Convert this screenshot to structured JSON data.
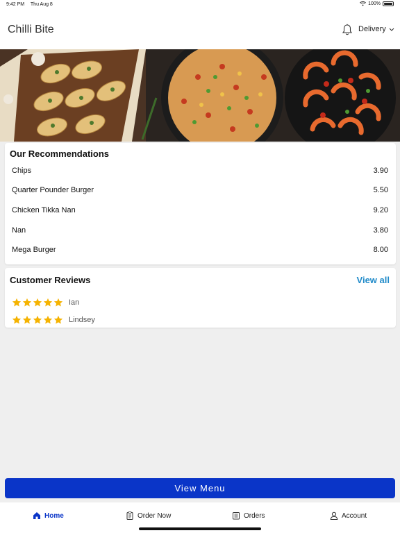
{
  "status_bar": {
    "time": "9:42 PM",
    "date": "Thu Aug 8",
    "battery": "100%"
  },
  "header": {
    "title": "Chilli Bite",
    "mode_label": "Delivery",
    "bell_icon": "bell-icon",
    "chevron_icon": "chevron-down-icon"
  },
  "recommendations": {
    "title": "Our Recommendations",
    "items": [
      {
        "name": "Chips",
        "price": "3.90"
      },
      {
        "name": "Quarter Pounder Burger",
        "price": "5.50"
      },
      {
        "name": "Chicken Tikka Nan",
        "price": "9.20"
      },
      {
        "name": "Nan",
        "price": "3.80"
      },
      {
        "name": "Mega Burger",
        "price": "8.00"
      }
    ]
  },
  "reviews": {
    "title": "Customer Reviews",
    "view_all": "View all",
    "items": [
      {
        "name": "Ian",
        "stars": 5
      },
      {
        "name": "Lindsey",
        "stars": 5
      }
    ]
  },
  "view_menu_label": "View Menu",
  "nav": {
    "items": [
      {
        "label": "Home",
        "icon": "home-icon",
        "active": true
      },
      {
        "label": "Order Now",
        "icon": "order-icon",
        "active": false
      },
      {
        "label": "Orders",
        "icon": "receipt-icon",
        "active": false
      },
      {
        "label": "Account",
        "icon": "user-icon",
        "active": false
      }
    ]
  },
  "colors": {
    "accent": "#0a35c8",
    "link": "#1f8ac9",
    "star": "#f5b301"
  }
}
